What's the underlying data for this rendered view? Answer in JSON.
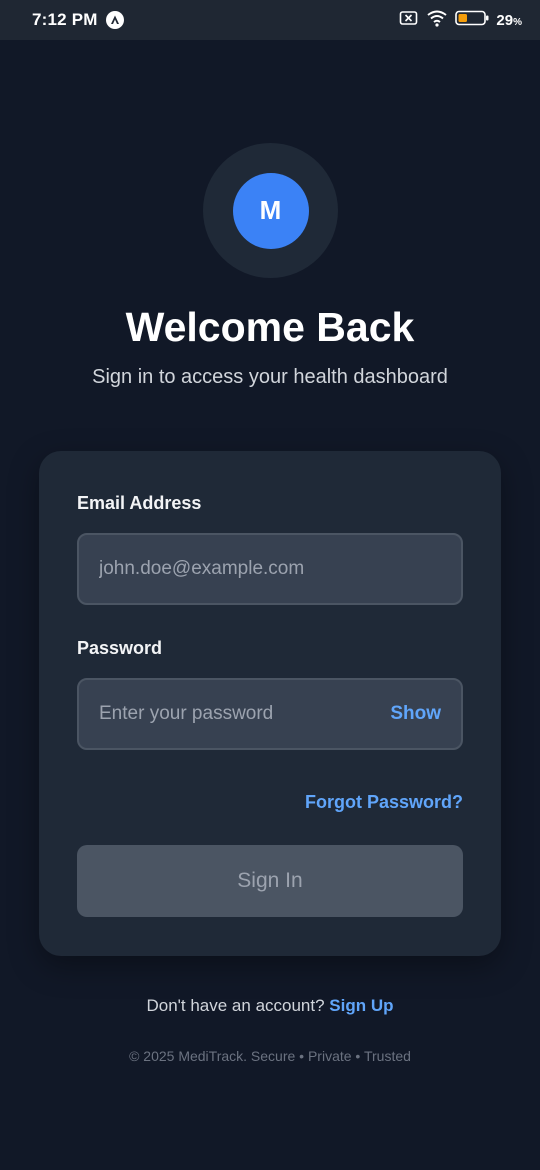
{
  "status_bar": {
    "time": "7:12 PM",
    "battery_value": "29",
    "battery_unit": "%",
    "icons": [
      "app-a-icon",
      "sim-off-icon",
      "wifi-icon",
      "battery-icon"
    ]
  },
  "logo": {
    "letter": "M",
    "color": "#3b82f6"
  },
  "header": {
    "title": "Welcome Back",
    "subtitle": "Sign in to access your health dashboard"
  },
  "form": {
    "email_label": "Email Address",
    "email_placeholder": "john.doe@example.com",
    "email_value": "",
    "password_label": "Password",
    "password_placeholder": "Enter your password",
    "password_value": "",
    "show_label": "Show",
    "forgot_label": "Forgot Password?",
    "signin_label": "Sign In"
  },
  "signup": {
    "prompt": "Don't have an account?",
    "link": "Sign Up"
  },
  "footer": {
    "text": "© 2025 MediTrack. Secure • Private • Trusted"
  },
  "colors": {
    "background": "#111827",
    "card": "#1f2937",
    "accent": "#60a5fa",
    "brand": "#3b82f6"
  }
}
